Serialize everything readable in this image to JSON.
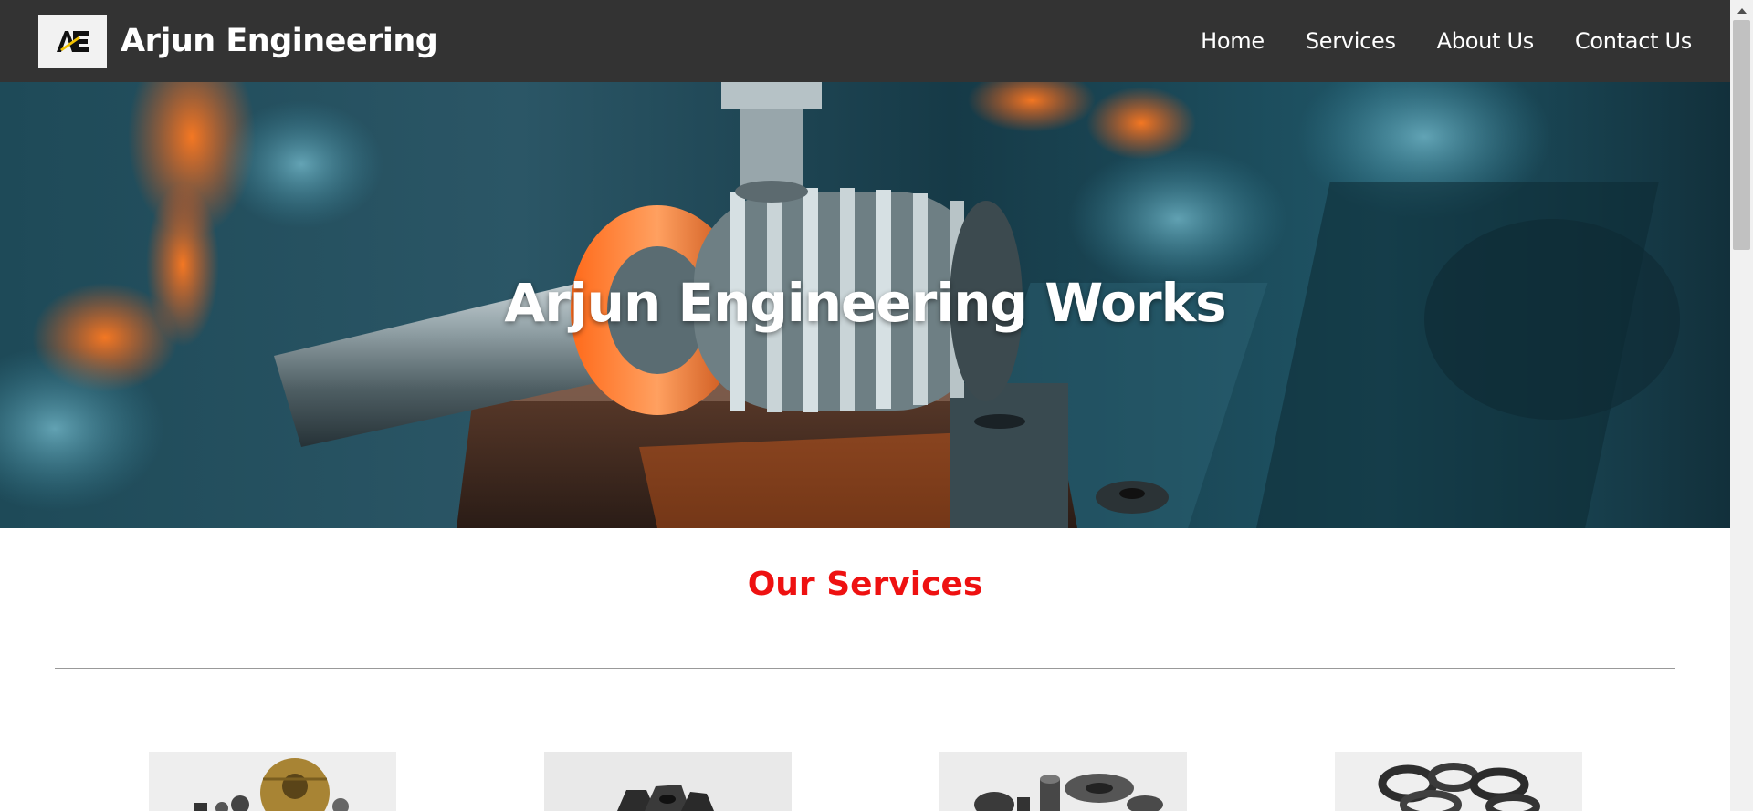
{
  "header": {
    "logo_text": "AE",
    "brand_name": "Arjun Engineering",
    "nav": [
      {
        "label": "Home"
      },
      {
        "label": "Services"
      },
      {
        "label": "About Us"
      },
      {
        "label": "Contact Us"
      }
    ]
  },
  "hero": {
    "title": "Arjun Engineering Works",
    "image_subject": "CNC machine spindle close-up"
  },
  "services": {
    "heading": "Our Services",
    "cards": [
      {
        "image_subject": "brass gear and machined fasteners"
      },
      {
        "image_subject": "hex nuts"
      },
      {
        "image_subject": "bolts and washers"
      },
      {
        "image_subject": "machined rings"
      }
    ]
  },
  "colors": {
    "navbar": "#333333",
    "heading_accent": "#ee1111",
    "hero_teal": "#173542",
    "hero_orange": "#ff6a1a"
  },
  "icons": {
    "scroll_up": "caret-up-icon"
  }
}
